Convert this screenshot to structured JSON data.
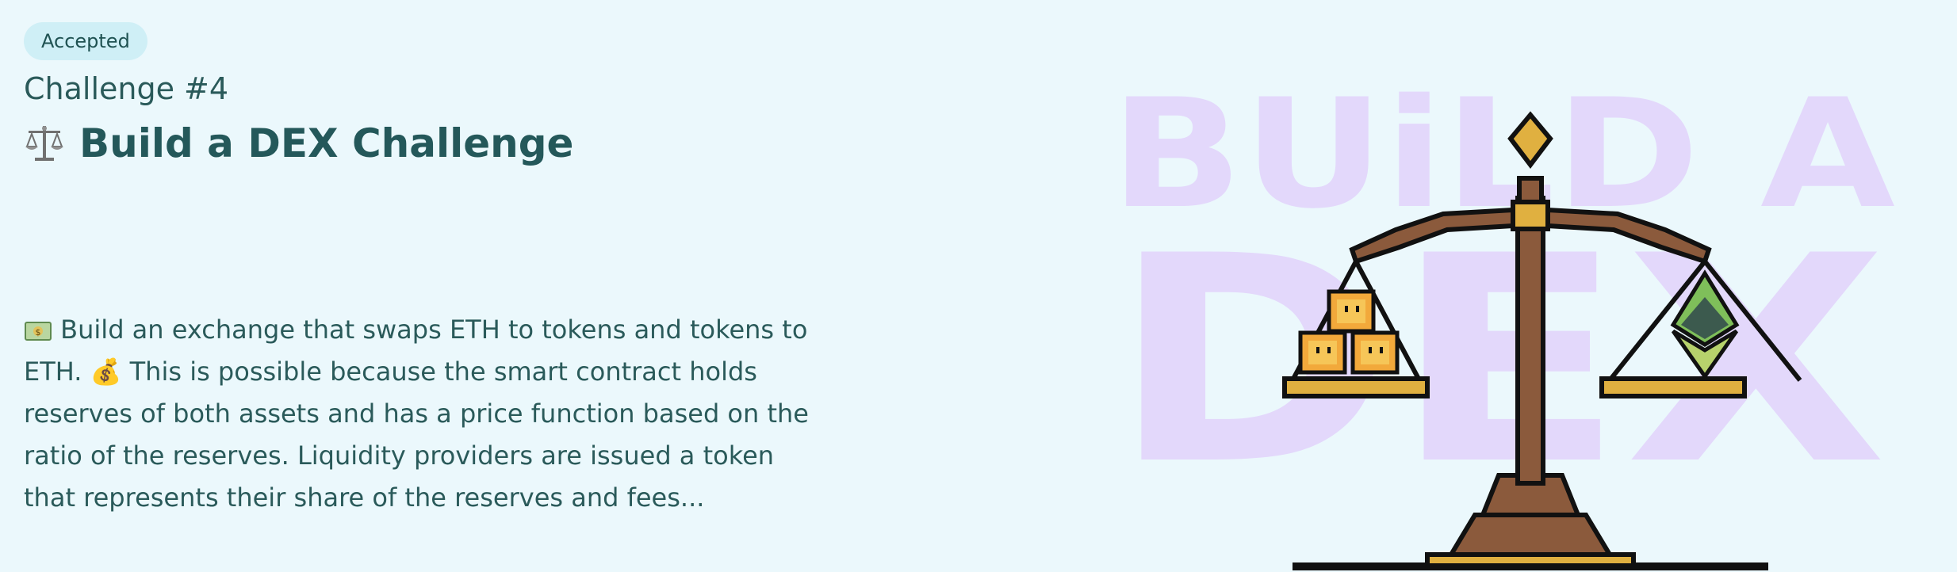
{
  "status_badge": "Accepted",
  "challenge_number": "Challenge #4",
  "challenge_title": "Build a DEX Challenge",
  "description": "Build an exchange that swaps ETH to tokens and tokens to ETH. 💰 This is possible because the smart contract holds reserves of both assets and has a price function based on the ratio of the reserves. Liquidity providers are issued a token that represents their share of the reserves and fees...",
  "hero_text_line1": "BUiLD A",
  "hero_text_line2": "DEX",
  "icons": {
    "title": "balance-scale-icon",
    "description": "money-bills-icon",
    "hero": "pixel-balance-scale-illustration"
  },
  "colors": {
    "background": "#ebf8fc",
    "badge_bg": "#cfeff6",
    "text": "#2a5a5a",
    "hero_text": "#e3d8fb",
    "scale_wood": "#8b5a3c",
    "gold": "#e0b040"
  }
}
